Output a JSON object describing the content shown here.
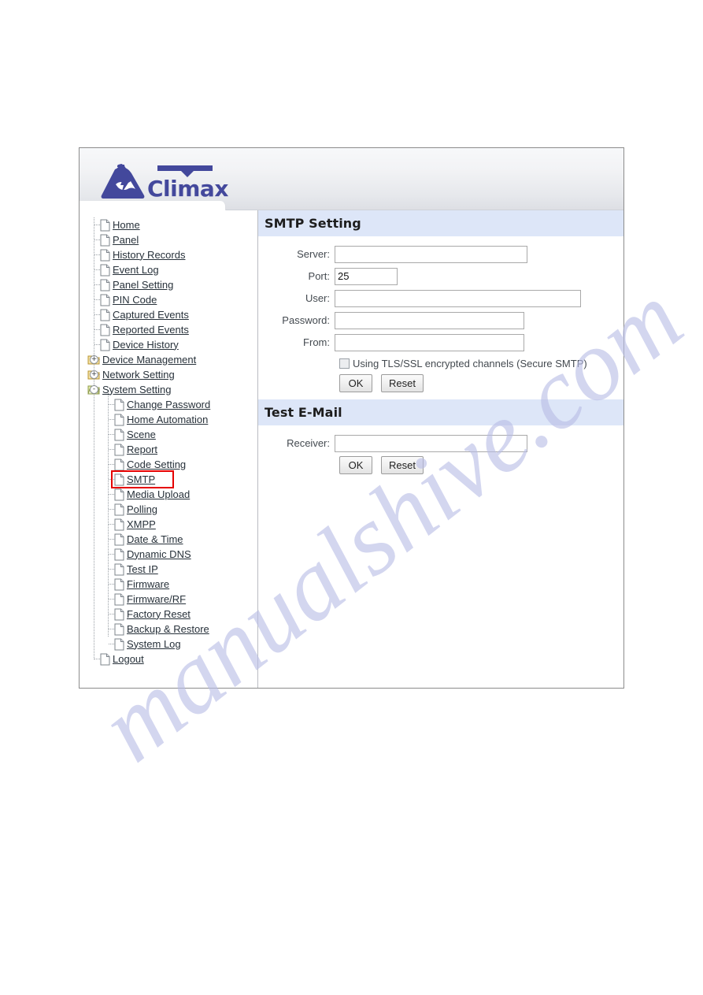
{
  "app": {
    "brand": "Climax",
    "logo_icon": "mountain-lightning-logo"
  },
  "sidebar": {
    "items": [
      {
        "label": "Home",
        "level": 1,
        "icon": "page-icon",
        "expander": null
      },
      {
        "label": "Panel",
        "level": 1,
        "icon": "page-icon",
        "expander": null
      },
      {
        "label": "History Records",
        "level": 1,
        "icon": "page-icon",
        "expander": null
      },
      {
        "label": "Event Log",
        "level": 1,
        "icon": "page-icon",
        "expander": null
      },
      {
        "label": "Panel Setting",
        "level": 1,
        "icon": "page-icon",
        "expander": null
      },
      {
        "label": "PIN Code",
        "level": 1,
        "icon": "page-icon",
        "expander": null
      },
      {
        "label": "Captured Events",
        "level": 1,
        "icon": "page-icon",
        "expander": null
      },
      {
        "label": "Reported Events",
        "level": 1,
        "icon": "page-icon",
        "expander": null
      },
      {
        "label": "Device History",
        "level": 1,
        "icon": "page-icon",
        "expander": null
      },
      {
        "label": "Device Management",
        "level": 1,
        "icon": "folder-icon",
        "expander": "+"
      },
      {
        "label": "Network Setting",
        "level": 1,
        "icon": "folder-icon",
        "expander": "+"
      },
      {
        "label": "System Setting",
        "level": 1,
        "icon": "folder-open-icon",
        "expander": "-"
      },
      {
        "label": "Change Password",
        "level": 2,
        "icon": "page-icon",
        "expander": null
      },
      {
        "label": "Home Automation",
        "level": 2,
        "icon": "page-icon",
        "expander": null
      },
      {
        "label": "Scene",
        "level": 2,
        "icon": "page-icon",
        "expander": null
      },
      {
        "label": "Report",
        "level": 2,
        "icon": "page-icon",
        "expander": null
      },
      {
        "label": "Code Setting",
        "level": 2,
        "icon": "page-icon",
        "expander": null
      },
      {
        "label": "SMTP",
        "level": 2,
        "icon": "page-icon",
        "expander": null,
        "highlighted": true
      },
      {
        "label": "Media Upload",
        "level": 2,
        "icon": "page-icon",
        "expander": null
      },
      {
        "label": "Polling",
        "level": 2,
        "icon": "page-icon",
        "expander": null
      },
      {
        "label": "XMPP",
        "level": 2,
        "icon": "page-icon",
        "expander": null
      },
      {
        "label": "Date & Time",
        "level": 2,
        "icon": "page-icon",
        "expander": null
      },
      {
        "label": "Dynamic DNS",
        "level": 2,
        "icon": "page-icon",
        "expander": null
      },
      {
        "label": "Test IP",
        "level": 2,
        "icon": "page-icon",
        "expander": null
      },
      {
        "label": "Firmware",
        "level": 2,
        "icon": "page-icon",
        "expander": null
      },
      {
        "label": "Firmware/RF",
        "level": 2,
        "icon": "page-icon",
        "expander": null
      },
      {
        "label": "Factory Reset",
        "level": 2,
        "icon": "page-icon",
        "expander": null
      },
      {
        "label": "Backup & Restore",
        "level": 2,
        "icon": "page-icon",
        "expander": null
      },
      {
        "label": "System Log",
        "level": 2,
        "icon": "page-icon",
        "expander": null
      },
      {
        "label": "Logout",
        "level": 1,
        "icon": "page-icon",
        "expander": null
      }
    ]
  },
  "smtp_setting": {
    "title": "SMTP Setting",
    "fields": {
      "server_label": "Server:",
      "server_value": "",
      "port_label": "Port:",
      "port_value": "25",
      "user_label": "User:",
      "user_value": "",
      "password_label": "Password:",
      "password_value": "",
      "from_label": "From:",
      "from_value": ""
    },
    "tls_checkbox_label": "Using TLS/SSL encrypted channels (Secure SMTP)",
    "tls_checked": false,
    "ok_label": "OK",
    "reset_label": "Reset"
  },
  "test_email": {
    "title": "Test E-Mail",
    "receiver_label": "Receiver:",
    "receiver_value": "",
    "ok_label": "OK",
    "reset_label": "Reset"
  },
  "watermark": {
    "text": "manualshive.com"
  },
  "colors": {
    "brand": "#43489c",
    "panel_header": "#dde6f8",
    "highlight_box": "#e50000",
    "link_text": "#27313a"
  }
}
